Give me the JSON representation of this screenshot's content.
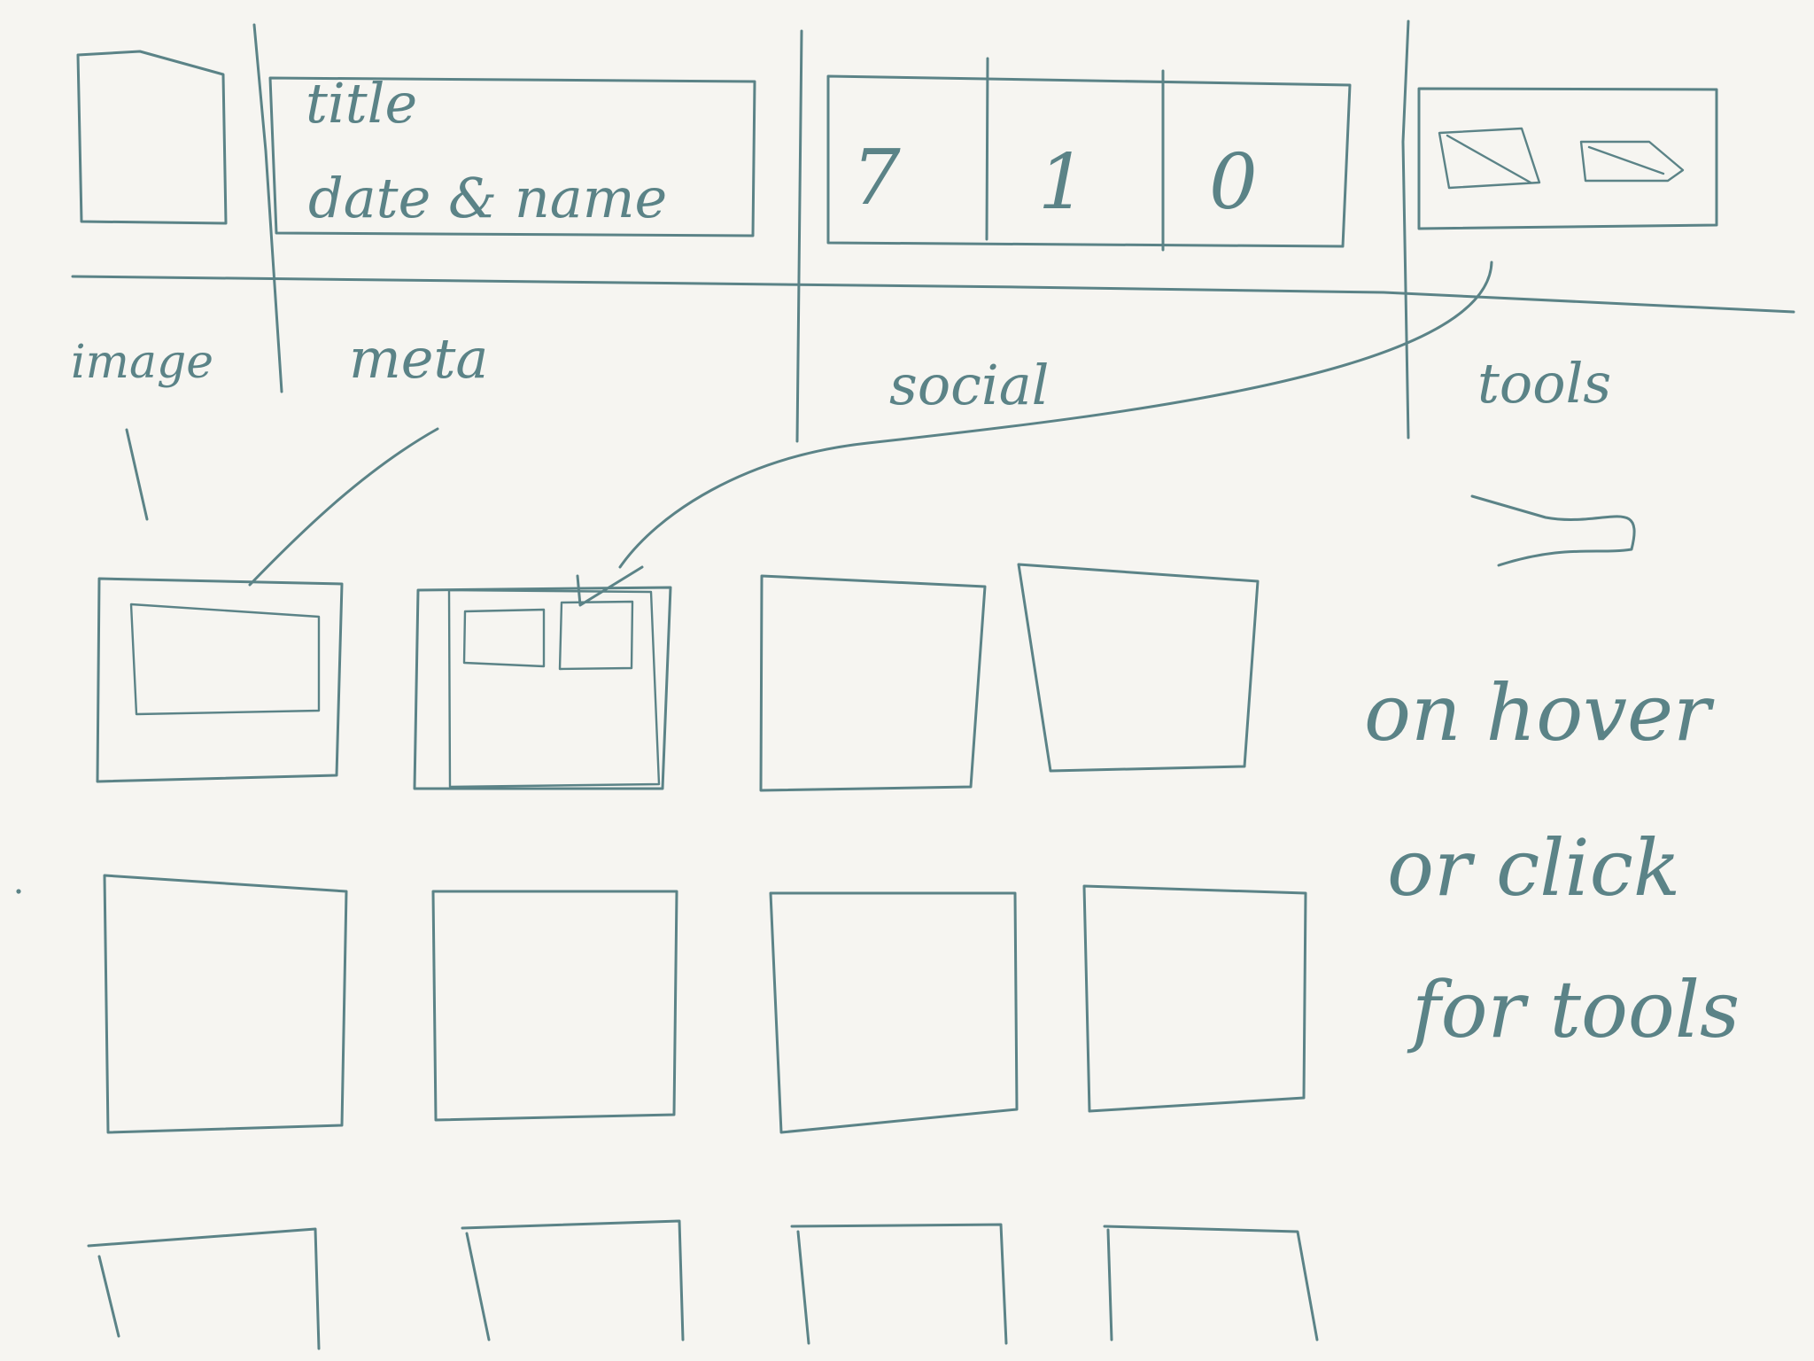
{
  "header": {
    "title_line1": "title",
    "title_line2": "date & name",
    "stats": [
      "7",
      "1",
      "0"
    ],
    "sections": {
      "image": "image",
      "meta": "meta",
      "social": "social",
      "tools": "tools"
    }
  },
  "annotation": {
    "line1": "on hover",
    "line2": "or click",
    "line3": "for tools"
  }
}
